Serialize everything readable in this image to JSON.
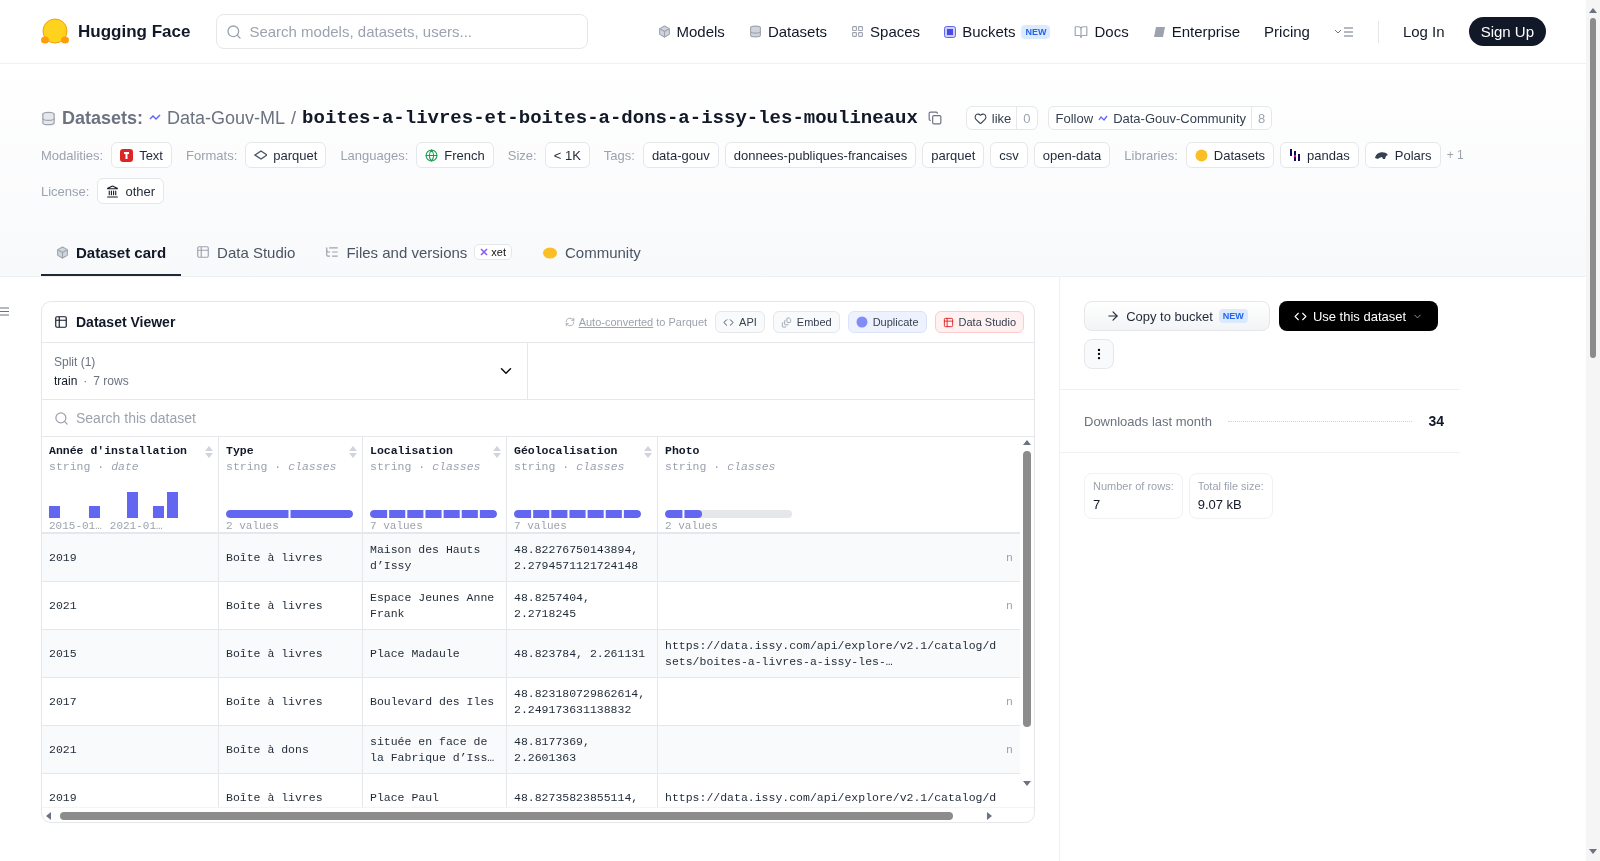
{
  "header": {
    "logo_text": "Hugging Face",
    "search": {
      "placeholder": "Search models, datasets, users..."
    },
    "nav": [
      {
        "label": "Models",
        "kind": "cube"
      },
      {
        "label": "Datasets",
        "kind": "db"
      },
      {
        "label": "Spaces",
        "kind": "grid"
      },
      {
        "label": "Buckets",
        "kind": "bucket",
        "badge": "NEW"
      },
      {
        "label": "Docs",
        "kind": "book"
      },
      {
        "label": "Enterprise",
        "kind": "enterprise"
      },
      {
        "label": "Pricing",
        "kind": "plain"
      }
    ],
    "log_in": "Log In",
    "sign_up": "Sign Up"
  },
  "dataset": {
    "prefix": "Datasets:",
    "owner": "Data-Gouv-ML",
    "separator": "/",
    "name": "boites-a-livres-et-boites-a-dons-a-issy-les-moulineaux",
    "like": {
      "label": "like",
      "count": "0"
    },
    "follow": {
      "label": "Follow",
      "org": "Data-Gouv-Community",
      "count": "8"
    }
  },
  "meta_rows": [
    [
      {
        "label": "Modalities:",
        "chips": [
          {
            "text": "Text",
            "kind": "text"
          }
        ]
      },
      {
        "label": "Formats:",
        "chips": [
          {
            "text": "parquet",
            "kind": "parquet"
          }
        ]
      },
      {
        "label": "Languages:",
        "chips": [
          {
            "text": "French",
            "kind": "globe"
          }
        ]
      },
      {
        "label": "Size:",
        "chips": [
          {
            "text": "< 1K",
            "kind": "plain"
          }
        ]
      },
      {
        "label": "Tags:",
        "chips": [
          {
            "text": "data-gouv",
            "kind": "plain"
          },
          {
            "text": "donnees-publiques-francaises",
            "kind": "plain"
          },
          {
            "text": "parquet",
            "kind": "plain"
          },
          {
            "text": "csv",
            "kind": "plain"
          },
          {
            "text": "open-data",
            "kind": "plain"
          }
        ]
      },
      {
        "label": "Libraries:",
        "chips": [
          {
            "text": "Datasets",
            "kind": "hf"
          },
          {
            "text": "pandas",
            "kind": "pandas"
          },
          {
            "text": "Polars",
            "kind": "polars"
          }
        ],
        "more": "+ 1"
      }
    ],
    [
      {
        "label": "License:",
        "chips": [
          {
            "text": "other",
            "kind": "license"
          }
        ]
      }
    ]
  ],
  "tabs": [
    {
      "label": "Dataset card",
      "kind": "cube",
      "selected": true
    },
    {
      "label": "Data Studio",
      "kind": "table",
      "selected": false
    },
    {
      "label": "Files and versions",
      "kind": "files",
      "badge": "xet",
      "selected": false
    },
    {
      "label": "Community",
      "kind": "hands",
      "selected": false
    }
  ],
  "viewer": {
    "title": "Dataset Viewer",
    "conversion": {
      "link": "Auto-converted",
      "rest": "to Parquet"
    },
    "actions": [
      {
        "label": "API",
        "kind": "api"
      },
      {
        "label": "Embed",
        "kind": "embed"
      },
      {
        "label": "Duplicate",
        "kind": "duplicate"
      },
      {
        "label": "Data Studio",
        "kind": "studio"
      }
    ],
    "split": {
      "label": "Split (1)",
      "name": "train",
      "dot": "·",
      "rows": "7 rows"
    },
    "search": {
      "placeholder": "Search this dataset"
    },
    "columns": [
      {
        "name": "Année d'installation",
        "type": "string",
        "dot": "·",
        "subtype": "date",
        "kind": "histogram",
        "axis_labels": [
          "2015-01…",
          "2021-01…"
        ]
      },
      {
        "name": "Type",
        "type": "string",
        "dot": "·",
        "subtype": "classes",
        "kind": "classes",
        "level": 1,
        "stats": "2 values"
      },
      {
        "name": "Localisation",
        "type": "string",
        "dot": "·",
        "subtype": "classes",
        "kind": "classes",
        "level": 1,
        "stats": "7 values"
      },
      {
        "name": "Géolocalisation",
        "type": "string",
        "dot": "·",
        "subtype": "classes",
        "kind": "classes",
        "level": 1,
        "stats": "7 values"
      },
      {
        "name": "Photo",
        "type": "string",
        "dot": "·",
        "subtype": "classes",
        "kind": "classes",
        "level": 0.29,
        "stats": "2 values"
      }
    ],
    "rows": [
      {
        "cells": [
          "2019",
          "Boîte à livres",
          "Maison des Hauts d’Issy",
          "48.82276750143894, 2.2794571121724148",
          "n"
        ]
      },
      {
        "cells": [
          "2021",
          "Boîte à livres",
          "Espace Jeunes Anne Frank",
          "48.8257404, 2.2718245",
          "n"
        ]
      },
      {
        "cells": [
          "2015",
          "Boîte à livres",
          "Place Madaule",
          "48.823784, 2.261131",
          "https://data.issy.com/api/explore/v2.1/catalog/d\nsets/boites-a-livres-a-issy-les-…"
        ]
      },
      {
        "cells": [
          "2017",
          "Boîte à livres",
          "Boulevard des Iles",
          "48.823180729862614, 2.249173631138832",
          "n"
        ]
      },
      {
        "cells": [
          "2021",
          "Boîte à dons",
          "située en face de\nla Fabrique d’Iss…",
          "48.8177369, 2.2601363",
          "n"
        ]
      },
      {
        "cells": [
          "2019",
          "Boîte à livres",
          "Place Paul",
          "48.82735823855114,",
          "https://data.issy.com/api/explore/v2.1/catalog/d"
        ]
      }
    ]
  },
  "sidebar": {
    "copy": {
      "label": "Copy to bucket",
      "badge": "NEW"
    },
    "use": "Use this dataset",
    "downloads": {
      "label": "Downloads last month",
      "value": "34"
    },
    "stats": [
      {
        "label": "Number of rows:",
        "value": "7"
      },
      {
        "label": "Total file size:",
        "value": "9.07 kB"
      }
    ]
  }
}
